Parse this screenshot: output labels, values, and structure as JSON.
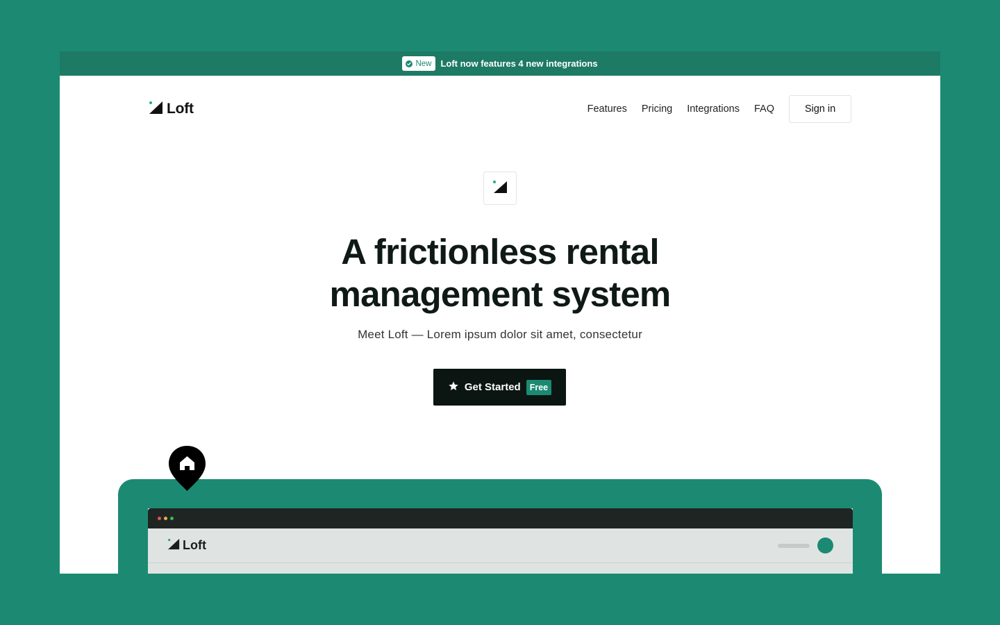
{
  "announcement": {
    "badge": "New",
    "text": "Loft now features 4 new integrations"
  },
  "nav": {
    "brand": "Loft",
    "links": [
      "Features",
      "Pricing",
      "Integrations",
      "FAQ"
    ],
    "signin": "Sign in"
  },
  "hero": {
    "title_line1": "A frictionless rental",
    "title_line2": "management system",
    "subtitle": "Meet Loft — Lorem ipsum dolor sit amet, consectetur",
    "cta_label": "Get Started",
    "cta_badge": "Free"
  },
  "preview": {
    "brand": "Loft"
  },
  "colors": {
    "background": "#1c8a72",
    "banner": "#1d7a64",
    "accent_dot": "#2ba58a",
    "cta_bg": "#0b1512",
    "browser_dot_red": "#e0564f",
    "browser_dot_yellow": "#e8b23b",
    "browser_dot_green": "#3fb65c"
  },
  "icons": {
    "badge": "check-circle-icon",
    "logo": "loft-logo-icon",
    "cta": "star-icon",
    "pin": "home-pin-icon"
  }
}
